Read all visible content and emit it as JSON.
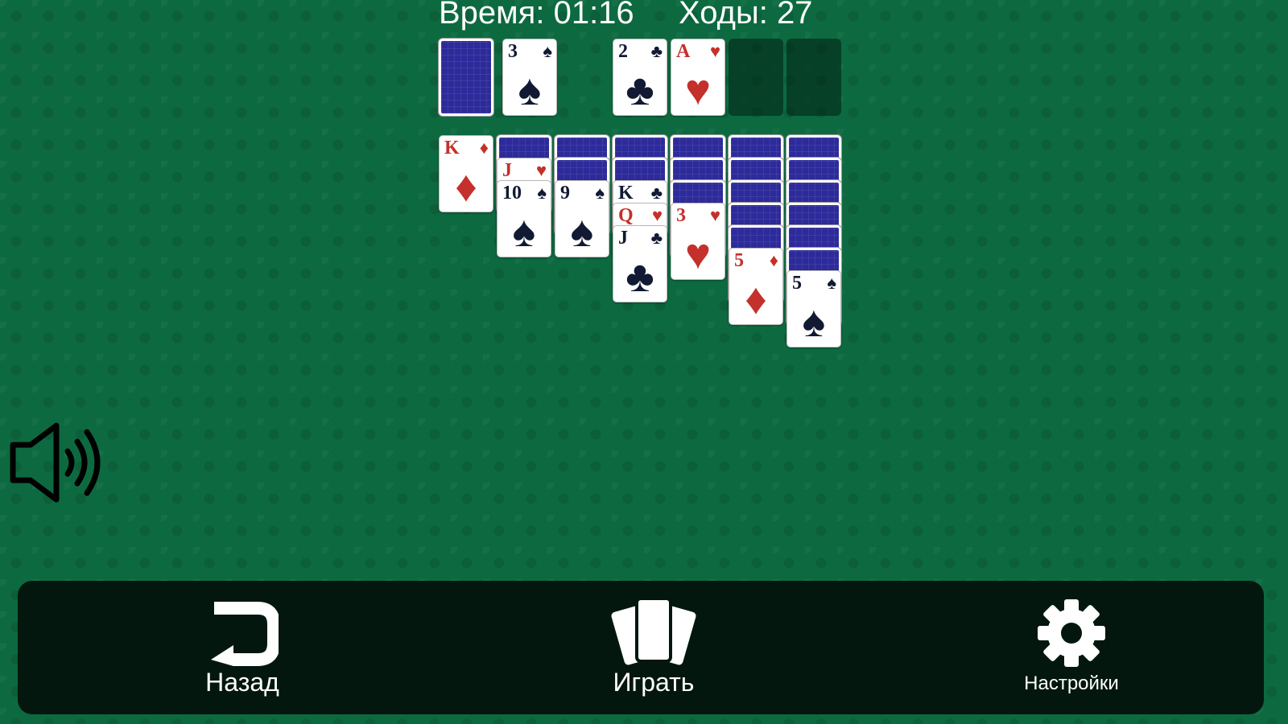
{
  "hud": {
    "time_label": "Время:",
    "time_value": "01:16",
    "moves_label": "Ходы:",
    "moves_value": "27"
  },
  "colors": {
    "felt": "#0d6a40",
    "card_back": "#2d2a9a",
    "red_suit": "#c4302b",
    "black_suit": "#111933",
    "bar": "#03170e"
  },
  "stock": {
    "icon": "card-back"
  },
  "waste": {
    "rank": "3",
    "suit": "♠",
    "color": "black"
  },
  "foundations": [
    {
      "rank": "2",
      "suit": "♣",
      "color": "black"
    },
    {
      "rank": "A",
      "suit": "♥",
      "color": "red"
    },
    null,
    null
  ],
  "tableau": [
    {
      "hidden": 0,
      "cards": [
        {
          "rank": "K",
          "suit": "♦",
          "color": "red"
        }
      ]
    },
    {
      "hidden": 1,
      "cards": [
        {
          "rank": "J",
          "suit": "♥",
          "color": "red"
        },
        {
          "rank": "10",
          "suit": "♠",
          "color": "black"
        }
      ]
    },
    {
      "hidden": 2,
      "cards": [
        {
          "rank": "9",
          "suit": "♠",
          "color": "black"
        }
      ]
    },
    {
      "hidden": 2,
      "cards": [
        {
          "rank": "K",
          "suit": "♣",
          "color": "black"
        },
        {
          "rank": "Q",
          "suit": "♥",
          "color": "red"
        },
        {
          "rank": "J",
          "suit": "♣",
          "color": "black"
        }
      ]
    },
    {
      "hidden": 3,
      "cards": [
        {
          "rank": "3",
          "suit": "♥",
          "color": "red"
        }
      ]
    },
    {
      "hidden": 5,
      "cards": [
        {
          "rank": "5",
          "suit": "♦",
          "color": "red"
        }
      ]
    },
    {
      "hidden": 6,
      "cards": [
        {
          "rank": "5",
          "suit": "♠",
          "color": "black"
        }
      ]
    }
  ],
  "sound": {
    "icon": "speaker-icon"
  },
  "bottom_bar": {
    "back_label": "Назад",
    "back_icon": "undo-icon",
    "play_label": "Играть",
    "play_icon": "cards-icon",
    "settings_label": "Настройки",
    "settings_icon": "gear-icon"
  }
}
